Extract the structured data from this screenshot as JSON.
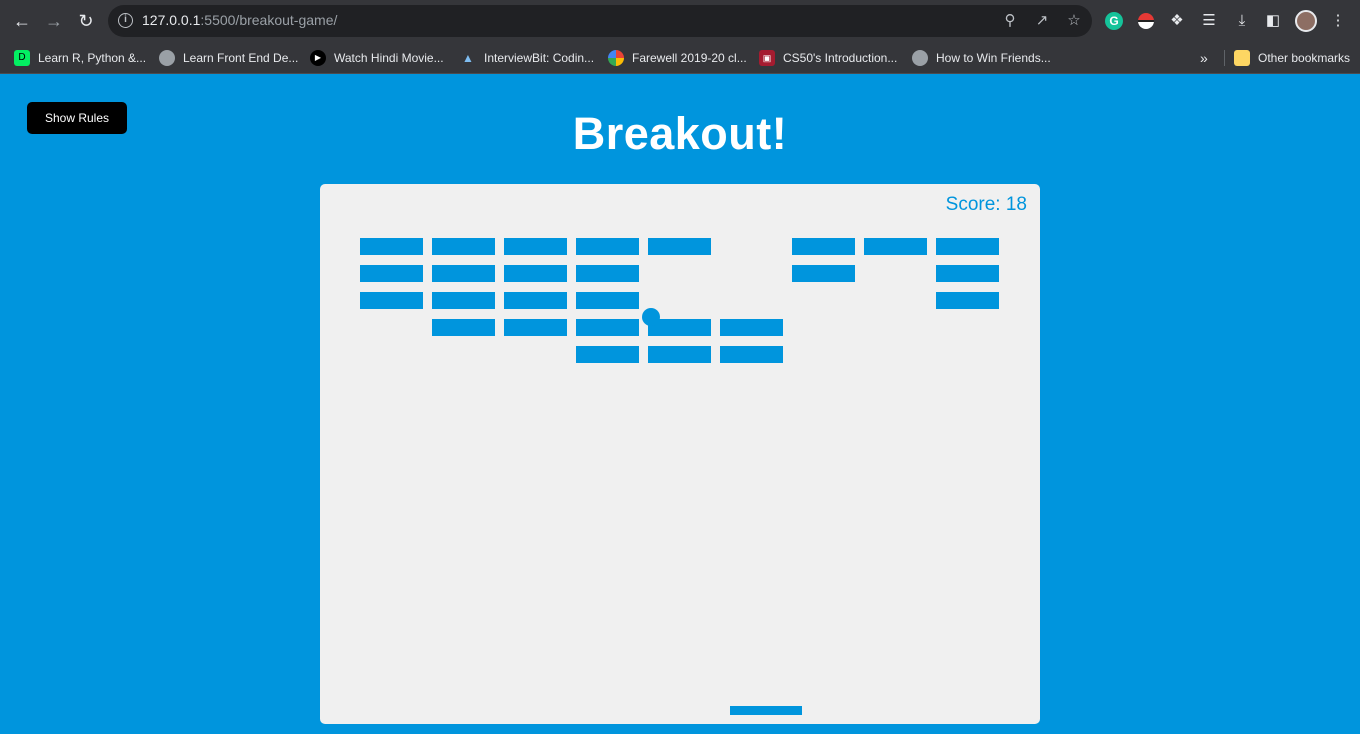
{
  "browser": {
    "url_host": "127.0.0.1",
    "url_rest": ":5500/breakout-game/",
    "bookmarks": [
      {
        "label": "Learn R, Python &...",
        "icon": "datacamp-icon",
        "color": "#03ef62"
      },
      {
        "label": "Learn Front End De...",
        "icon": "globe-icon",
        "color": "#9aa0a6"
      },
      {
        "label": "Watch Hindi Movie...",
        "icon": "play-icon",
        "color": "#000000"
      },
      {
        "label": "InterviewBit: Codin...",
        "icon": "interviewbit-icon",
        "color": "#7fbdf0"
      },
      {
        "label": "Farewell 2019-20 cl...",
        "icon": "photos-pinwheel-icon",
        "color": "#fbbc04"
      },
      {
        "label": "CS50's Introduction...",
        "icon": "harvard-shield-icon",
        "color": "#a51c30"
      },
      {
        "label": "How to Win Friends...",
        "icon": "globe-icon",
        "color": "#9aa0a6"
      }
    ],
    "other_bookmarks": "Other bookmarks"
  },
  "page": {
    "rules_button": "Show Rules",
    "title": "Breakout!",
    "score_label": "Score: 18"
  },
  "game": {
    "brick_color": "#0095dd",
    "background": "#f0f0f0",
    "columns": 9,
    "rows": 5,
    "bricks_visible": [
      [
        1,
        1,
        1,
        1,
        1,
        0,
        1,
        1,
        1
      ],
      [
        1,
        1,
        1,
        1,
        0,
        0,
        1,
        0,
        1
      ],
      [
        1,
        1,
        1,
        1,
        0,
        0,
        0,
        0,
        1
      ],
      [
        0,
        1,
        1,
        1,
        1,
        1,
        0,
        0,
        0
      ],
      [
        0,
        0,
        0,
        1,
        1,
        1,
        0,
        0,
        0
      ]
    ]
  }
}
